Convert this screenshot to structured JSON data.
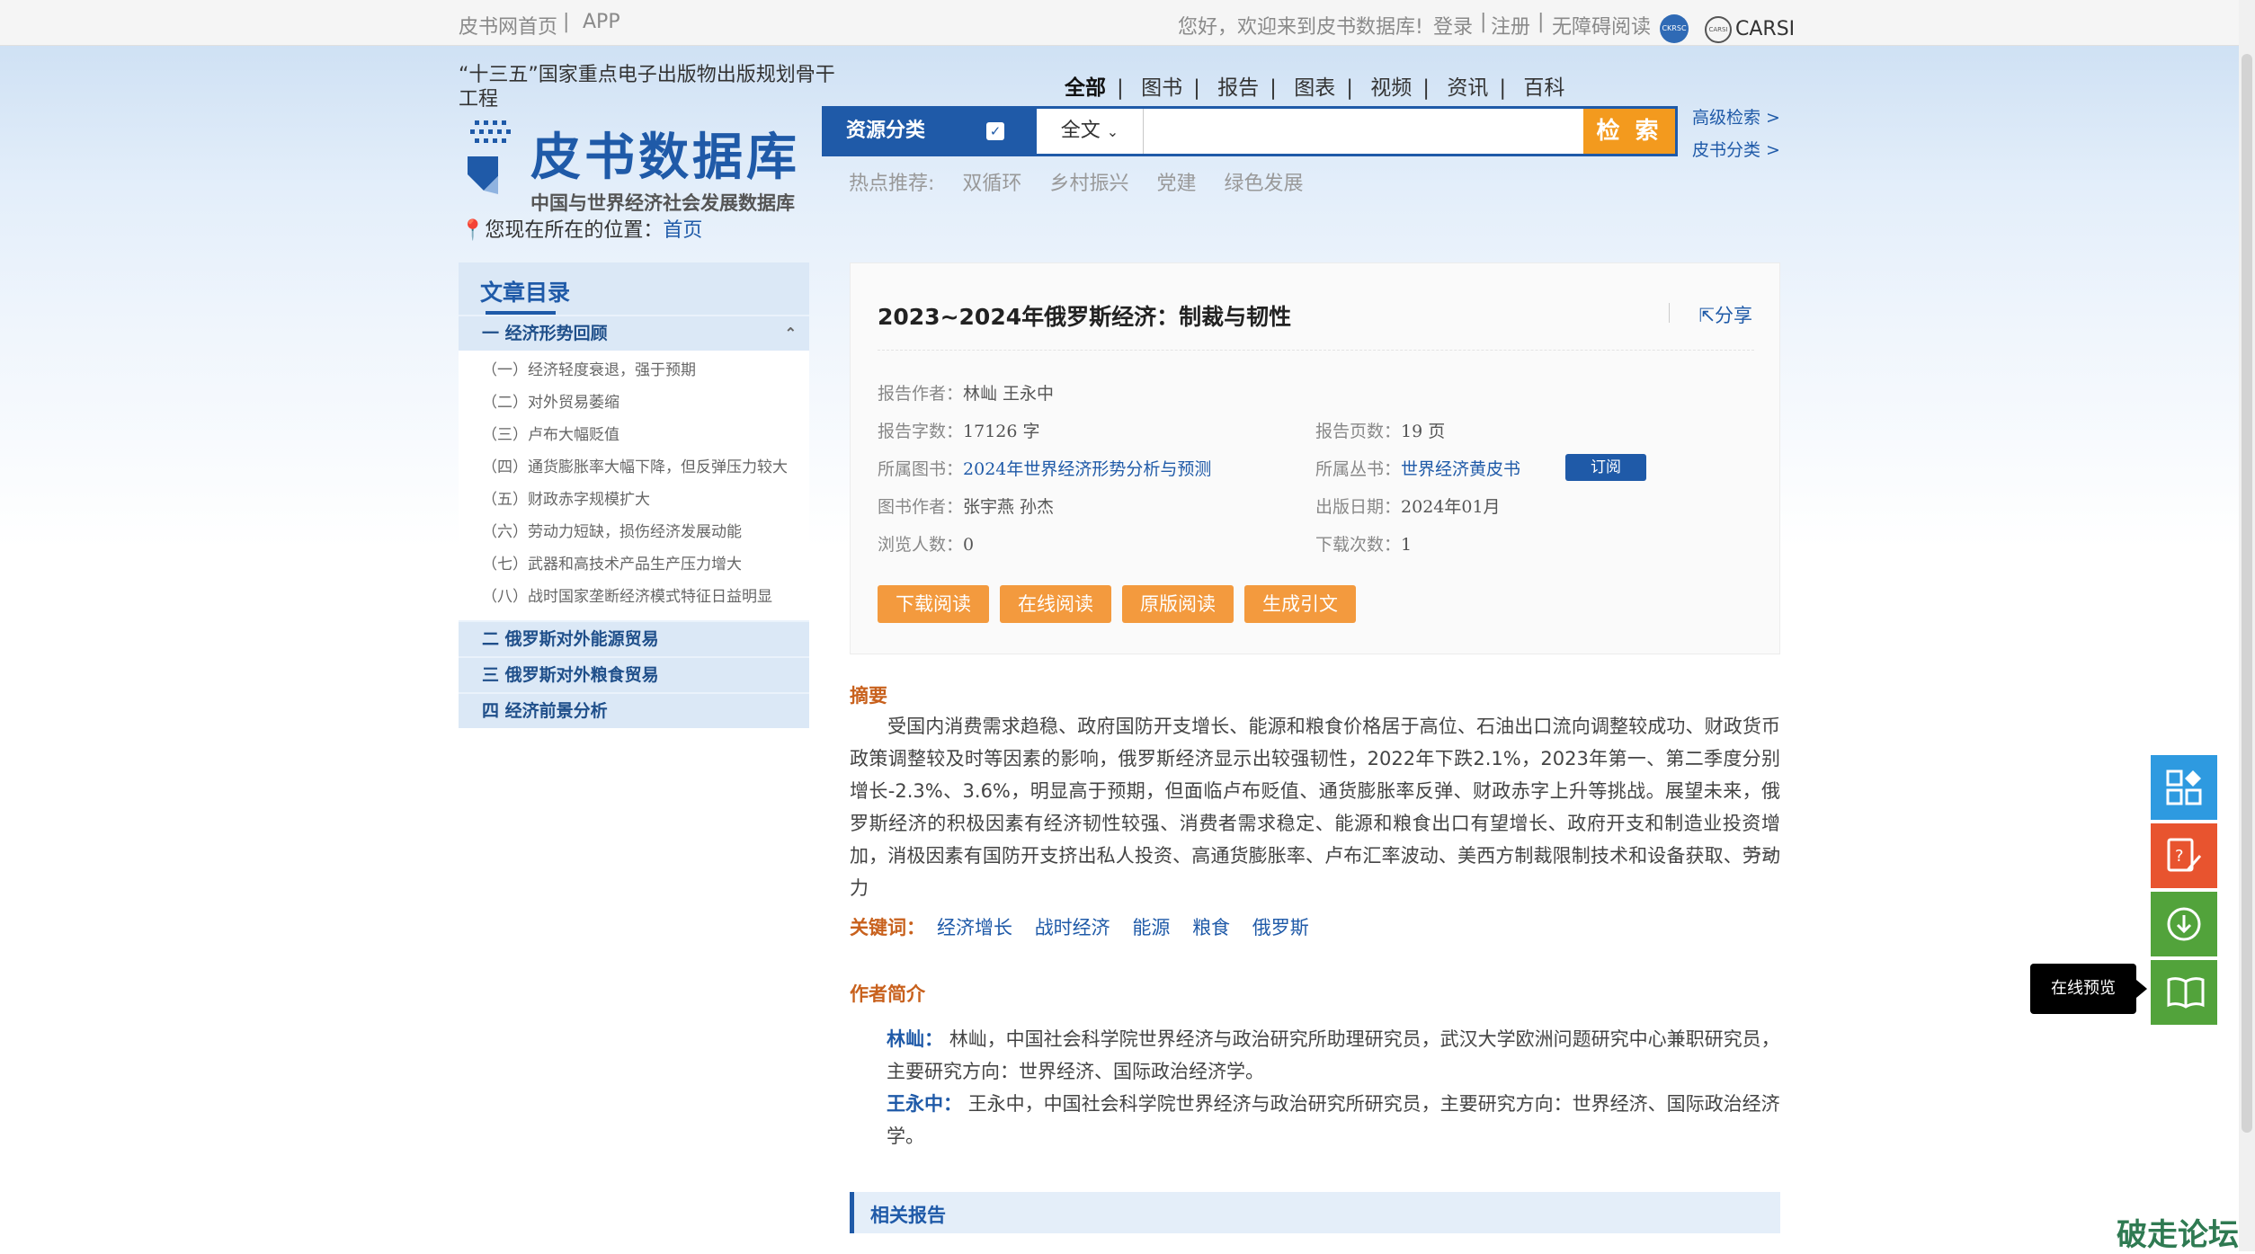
{
  "topbar": {
    "home_link": "皮书网首页",
    "sep": "|",
    "app_link": "APP",
    "welcome": "您好，欢迎来到皮书数据库!",
    "login": "登录",
    "register": "注册",
    "accessible": "无障碍阅读",
    "carsi": "CARSI"
  },
  "header": {
    "project_line": "“十三五”国家重点电子出版物出版规划骨干工程",
    "brand_title": "皮书数据库",
    "brand_subtitle": "中国与世界经济社会发展数据库",
    "location_prefix": "您现在所在的位置：",
    "location_link": "首页"
  },
  "category_tabs": [
    {
      "label": "全部",
      "active": true
    },
    {
      "label": "图书",
      "active": false
    },
    {
      "label": "报告",
      "active": false
    },
    {
      "label": "图表",
      "active": false
    },
    {
      "label": "视频",
      "active": false
    },
    {
      "label": "资讯",
      "active": false
    },
    {
      "label": "百科",
      "active": false
    }
  ],
  "search": {
    "resource_category": "资源分类",
    "scope": "全文",
    "query_placeholder": "",
    "button": "检 索",
    "advanced": "高级检索 >",
    "classification": "皮书分类 >",
    "hot_label": "热点推荐:",
    "hot_items": [
      "双循环",
      "乡村振兴",
      "党建",
      "绿色发展"
    ]
  },
  "toc": {
    "title": "文章目录",
    "sections": [
      {
        "label": "一  经济形势回顾",
        "expanded": true,
        "items": [
          "（一）经济轻度衰退，强于预期",
          "（二）对外贸易萎缩",
          "（三）卢布大幅贬值",
          "（四）通货膨胀率大幅下降，但反弹压力较大",
          "（五）财政赤字规模扩大",
          "（六）劳动力短缺，损伤经济发展动能",
          "（七）武器和高技术产品生产压力增大",
          "（八）战时国家垄断经济模式特征日益明显"
        ]
      },
      {
        "label": "二  俄罗斯对外能源贸易",
        "expanded": false,
        "items": []
      },
      {
        "label": "三  俄罗斯对外粮食贸易",
        "expanded": false,
        "items": []
      },
      {
        "label": "四  经济前景分析",
        "expanded": false,
        "items": []
      }
    ]
  },
  "report": {
    "title": "2023~2024年俄罗斯经济：制裁与韧性",
    "share": "分享",
    "author_label": "报告作者：",
    "author_value": "林屾  王永中",
    "words_label": "报告字数：",
    "words_value": "17126    字",
    "pages_label": "报告页数：",
    "pages_value": "19    页",
    "book_label": "所属图书：",
    "book_value": "2024年世界经济形势分析与预测",
    "series_label": "所属丛书：",
    "series_value": "世界经济黄皮书",
    "subscribe": "订阅",
    "book_author_label": "图书作者：",
    "book_author_value": "张宇燕  孙杰",
    "pub_date_label": "出版日期：",
    "pub_date_value": "2024年01月",
    "views_label": "浏览人数：",
    "views_value": "0",
    "downloads_label": "下载次数：",
    "downloads_value": "1",
    "buttons": [
      "下载阅读",
      "在线阅读",
      "原版阅读",
      "生成引文"
    ]
  },
  "abstract": {
    "heading": "摘要",
    "text": "受国内消费需求趋稳、政府国防开支增长、能源和粮食价格居于高位、石油出口流向调整较成功、财政货币政策调整较及时等因素的影响，俄罗斯经济显示出较强韧性，2022年下跌2.1%，2023年第一、第二季度分别增长-2.3%、3.6%，明显高于预期，但面临卢布贬值、通货膨胀率反弹、财政赤字上升等挑战。展望未来，俄罗斯经济的积极因素有经济韧性较强、消费者需求稳定、能源和粮食出口有望增长、政府开支和制造业投资增加，消极因素有国防开支挤出私人投资、高通货膨胀率、卢布汇率波动、美西方制裁限制技术和设备获取、劳动力",
    "more": ">>"
  },
  "keywords": {
    "heading": "关键词：",
    "items": [
      "经济增长",
      "战时经济",
      "能源",
      "粮食",
      "俄罗斯"
    ]
  },
  "authors": {
    "heading": "作者简介",
    "entries": [
      {
        "name": "林屾：",
        "bio": "林屾，中国社会科学院世界经济与政治研究所助理研究员，武汉大学欧洲问题研究中心兼职研究员，主要研究方向：世界经济、国际政治经济学。"
      },
      {
        "name": "王永中：",
        "bio": "王永中，中国社会科学院世界经济与政治研究所研究员，主要研究方向：世界经济、国际政治经济学。"
      }
    ]
  },
  "related": {
    "heading": "相关报告"
  },
  "tools": {
    "tooltip": "在线预览",
    "items": [
      {
        "icon": "grid-icon",
        "color": "#2e9ae0"
      },
      {
        "icon": "help-edit-icon",
        "color": "#e8542f"
      },
      {
        "icon": "download-icon",
        "color": "#52a33b"
      },
      {
        "icon": "book-icon",
        "color": "#52a33b"
      }
    ]
  },
  "watermark": "破走论坛",
  "colors": {
    "brand": "#1f5aa8",
    "accent": "#f39a1e",
    "heading": "#c8611d"
  }
}
